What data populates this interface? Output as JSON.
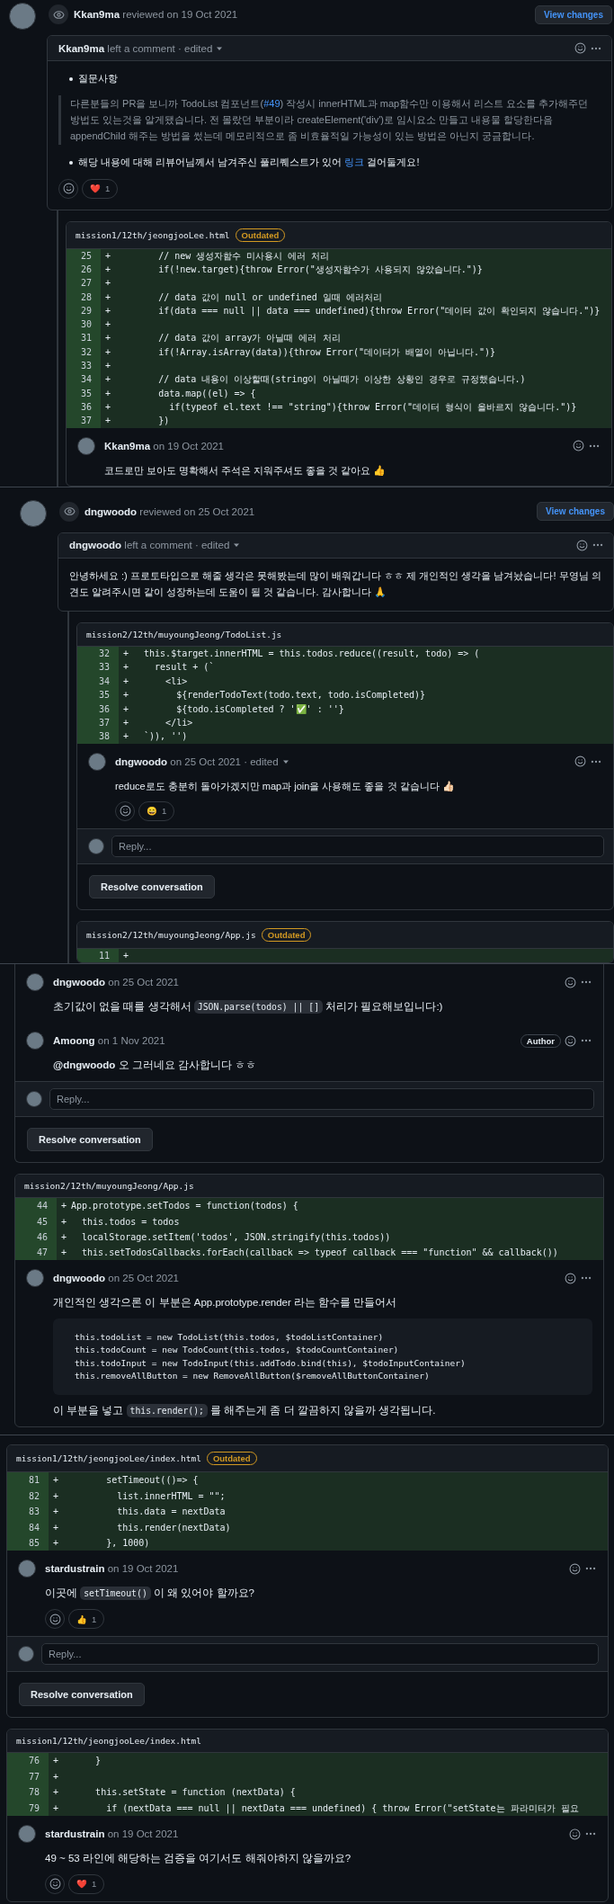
{
  "sections": [
    {
      "kind": "review",
      "reviewer": "Kkan9ma",
      "action": "reviewed on 19 Oct 2021",
      "button": "View changes",
      "comment": {
        "author": "Kkan9ma",
        "meta": "left a comment · edited",
        "dropdown": true,
        "blocks": [
          {
            "kind": "bullet",
            "parts": [
              {
                "kind": "text",
                "text": "질문사항"
              }
            ]
          },
          {
            "kind": "quote",
            "parts": [
              {
                "kind": "text",
                "text": "다른분들의 PR을 보니까 TodoList 컴포넌트("
              },
              {
                "kind": "link",
                "text": "#49"
              },
              {
                "kind": "text",
                "text": ") 작성시 innerHTML과 map함수만 이용해서 리스트 요소를 추가해주던 방법도 있는것을 알게됐습니다. 전 몰랐던 부분이라 createElement('div')로 임시요소 만들고 내용물 할당한다음 appendChild 해주는 방법을 썼는데 메모리적으로 좀 비효율적일 가능성이 있는 방법은 아닌지 궁금합니다."
              }
            ]
          },
          {
            "kind": "bullet",
            "parts": [
              {
                "kind": "text",
                "text": "해당 내용에 대해 리뷰어님께서 남겨주신 풀리퀘스트가 있어 "
              },
              {
                "kind": "link",
                "text": "링크"
              },
              {
                "kind": "text",
                "text": " 걸어둘게요!"
              }
            ]
          }
        ],
        "reactions": [
          {
            "emoji": "❤️",
            "count": "1"
          }
        ]
      },
      "threads": [
        {
          "file": "mission1/12th/jeongjooLee.html",
          "badge": "Outdated",
          "lines": [
            {
              "num": "25",
              "sign": "+",
              "code": "        // new 생성자함수 미사용시 에러 처리"
            },
            {
              "num": "26",
              "sign": "+",
              "code": "        if(!new.target){throw Error(\"생성자함수가 사용되지 않았습니다.\")}"
            },
            {
              "num": "27",
              "sign": "+"
            },
            {
              "num": "28",
              "sign": "+",
              "code": "        // data 값이 null or undefined 일때 에러처리"
            },
            {
              "num": "29",
              "sign": "+",
              "code": "        if(data === null || data === undefined){throw Error(\"데이터 값이 확인되지 않습니다.\")}"
            },
            {
              "num": "30",
              "sign": "+"
            },
            {
              "num": "31",
              "sign": "+",
              "code": "        // data 값이 array가 아닐때 에러 처리"
            },
            {
              "num": "32",
              "sign": "+",
              "code": "        if(!Array.isArray(data)){throw Error(\"데이터가 배열이 아닙니다.\")}"
            },
            {
              "num": "33",
              "sign": "+"
            },
            {
              "num": "34",
              "sign": "+",
              "code": "        // data 내용이 이상할때(string이 아닐때가 이상한 상황인 경우로 규정했습니다.)"
            },
            {
              "num": "35",
              "sign": "+",
              "code": "        data.map((el) => {"
            },
            {
              "num": "36",
              "sign": "+",
              "code": "          if(typeof el.text !== \"string\"){throw Error(\"데이터 형식이 올바르지 않습니다.\")}"
            },
            {
              "num": "37",
              "sign": "+",
              "code": "        })"
            }
          ],
          "comments": [
            {
              "author": "Kkan9ma",
              "meta": "on 19 Oct 2021",
              "blocks": [
                {
                  "kind": "para",
                  "parts": [
                    {
                      "kind": "text",
                      "text": "코드로만 보아도 명확해서 주석은 지워주셔도 좋을 것 같아요 👍"
                    }
                  ]
                }
              ]
            }
          ]
        }
      ]
    },
    {
      "kind": "review",
      "reviewer": "dngwoodo",
      "action": "reviewed on 25 Oct 2021",
      "button": "View changes",
      "comment": {
        "author": "dngwoodo",
        "meta": "left a comment · edited",
        "dropdown": true,
        "blocks": [
          {
            "kind": "para",
            "parts": [
              {
                "kind": "text",
                "text": "안녕하세요 :) 프로토타입으로 해줄 생각은 못해봤는데 많이 배워갑니다 ㅎㅎ 제 개인적인 생각을 남겨놨습니다! 무영님 의견도 알려주시면 같이 성장하는데 도움이 될 것 같습니다. 감사합니다 🙏"
              }
            ]
          }
        ]
      },
      "threads": [
        {
          "file": "mission2/12th/muyoungJeong/TodoList.js",
          "lines": [
            {
              "num": "32",
              "sign": "+",
              "code": "  this.$target.innerHTML = this.todos.reduce((result, todo) => ("
            },
            {
              "num": "33",
              "sign": "+",
              "code": "    result + (`"
            },
            {
              "num": "34",
              "sign": "+",
              "code": "      <li>"
            },
            {
              "num": "35",
              "sign": "+",
              "code": "        ${renderTodoText(todo.text, todo.isCompleted)}"
            },
            {
              "num": "36",
              "sign": "+",
              "code": "        ${todo.isCompleted ? '✅' : ''}"
            },
            {
              "num": "37",
              "sign": "+",
              "code": "      </li>"
            },
            {
              "num": "38",
              "sign": "+",
              "code": "  `)), '')"
            }
          ],
          "comments": [
            {
              "author": "dngwoodo",
              "meta": "on 25 Oct 2021 · edited",
              "dropdown": true,
              "blocks": [
                {
                  "kind": "para",
                  "parts": [
                    {
                      "kind": "text",
                      "text": "reduce로도 충분히 돌아가겠지만 map과 join을 사용해도 좋을 것 같습니다 👍🏻"
                    }
                  ]
                }
              ],
              "reactions": [
                {
                  "emoji": "😄",
                  "count": "1"
                }
              ]
            }
          ],
          "reply": {
            "placeholder": "Reply..."
          },
          "resolve": "Resolve conversation"
        },
        {
          "file": "mission2/12th/muyoungJeong/App.js",
          "badge": "Outdated",
          "lines": [
            {
              "num": "11",
              "sign": "+"
            }
          ]
        }
      ]
    },
    {
      "kind": "threads",
      "threads": [
        {
          "comments": [
            {
              "author": "dngwoodo",
              "meta": "on 25 Oct 2021",
              "blocks": [
                {
                  "kind": "para",
                  "parts": [
                    {
                      "kind": "text",
                      "text": "초기값이 없을 때를 생각해서 "
                    },
                    {
                      "kind": "code",
                      "text": "JSON.parse(todos) || []"
                    },
                    {
                      "kind": "text",
                      "text": " 처리가 필요해보입니다:)"
                    }
                  ]
                }
              ]
            },
            {
              "author": "Amoong",
              "meta": "on 1 Nov 2021",
              "badge": "Author",
              "blocks": [
                {
                  "kind": "para",
                  "parts": [
                    {
                      "kind": "mention",
                      "text": "@dngwoodo"
                    },
                    {
                      "kind": "text",
                      "text": " 오 그러네요 감사합니다 ㅎㅎ"
                    }
                  ]
                }
              ]
            }
          ],
          "reply": {
            "placeholder": "Reply..."
          },
          "resolve": "Resolve conversation"
        },
        {
          "file": "mission2/12th/muyoungJeong/App.js",
          "lines": [
            {
              "num": "44",
              "sign": "+",
              "code": "App.prototype.setTodos = function(todos) {"
            },
            {
              "num": "45",
              "sign": "+",
              "code": "  this.todos = todos"
            },
            {
              "num": "46",
              "sign": "+",
              "code": "  localStorage.setItem('todos', JSON.stringify(this.todos))"
            },
            {
              "num": "47",
              "sign": "+",
              "code": "  this.setTodosCallbacks.forEach(callback => typeof callback === \"function\" && callback())"
            }
          ],
          "comments": [
            {
              "author": "dngwoodo",
              "meta": "on 25 Oct 2021",
              "blocks": [
                {
                  "kind": "para",
                  "parts": [
                    {
                      "kind": "text",
                      "text": "개인적인 생각으론 이 부분은 App.prototype.render 라는 함수를 만들어서"
                    }
                  ]
                },
                {
                  "kind": "codeblock",
                  "lines": [
                    "this.todoList = new TodoList(this.todos, $todoListContainer)",
                    "this.todoCount = new TodoCount(this.todos, $todoCountContainer)",
                    "this.todoInput = new TodoInput(this.addTodo.bind(this), $todoInputContainer)",
                    "this.removeAllButton = new RemoveAllButton($removeAllButtonContainer)"
                  ]
                },
                {
                  "kind": "para",
                  "parts": [
                    {
                      "kind": "text",
                      "text": "이 부분을 넣고 "
                    },
                    {
                      "kind": "code",
                      "text": "this.render();"
                    },
                    {
                      "kind": "text",
                      "text": " 를 해주는게 좀 더 깔끔하지 않을까 생각됩니다."
                    }
                  ]
                }
              ]
            }
          ]
        }
      ]
    },
    {
      "kind": "threads",
      "threads": [
        {
          "file": "mission1/12th/jeongjooLee/index.html",
          "badge": "Outdated",
          "lines": [
            {
              "num": "81",
              "sign": "+",
              "code": "        setTimeout(()=> {"
            },
            {
              "num": "82",
              "sign": "+",
              "code": "          list.innerHTML = \"\";"
            },
            {
              "num": "83",
              "sign": "+",
              "code": "          this.data = nextData"
            },
            {
              "num": "84",
              "sign": "+",
              "code": "          this.render(nextData)"
            },
            {
              "num": "85",
              "sign": "+",
              "code": "        }, 1000)"
            }
          ],
          "comments": [
            {
              "author": "stardustrain",
              "meta": "on 19 Oct 2021",
              "blocks": [
                {
                  "kind": "para",
                  "parts": [
                    {
                      "kind": "text",
                      "text": "이곳에 "
                    },
                    {
                      "kind": "code",
                      "text": "setTimeout()"
                    },
                    {
                      "kind": "text",
                      "text": " 이 왜 있어야 할까요?"
                    }
                  ]
                }
              ],
              "reactions": [
                {
                  "emoji": "👍",
                  "count": "1"
                }
              ]
            }
          ],
          "reply": {
            "placeholder": "Reply..."
          },
          "resolve": "Resolve conversation"
        },
        {
          "file": "mission1/12th/jeongjooLee/index.html",
          "lines": [
            {
              "num": "76",
              "sign": "+",
              "code": "      }"
            },
            {
              "num": "77",
              "sign": "+"
            },
            {
              "num": "78",
              "sign": "+",
              "code": "      this.setState = function (nextData) {"
            },
            {
              "num": "79",
              "sign": "+",
              "code": "        if (nextData === null || nextData === undefined) { throw Error(\"setState는 파라미터가 필요"
            }
          ],
          "comments": [
            {
              "author": "stardustrain",
              "meta": "on 19 Oct 2021",
              "blocks": [
                {
                  "kind": "para",
                  "parts": [
                    {
                      "kind": "text",
                      "text": "49 ~ 53 라인에 해당하는 검증을 여기서도 해줘야하지 않을까요?"
                    }
                  ]
                }
              ],
              "reactions": [
                {
                  "emoji": "❤️",
                  "count": "1"
                }
              ]
            }
          ]
        }
      ]
    }
  ]
}
